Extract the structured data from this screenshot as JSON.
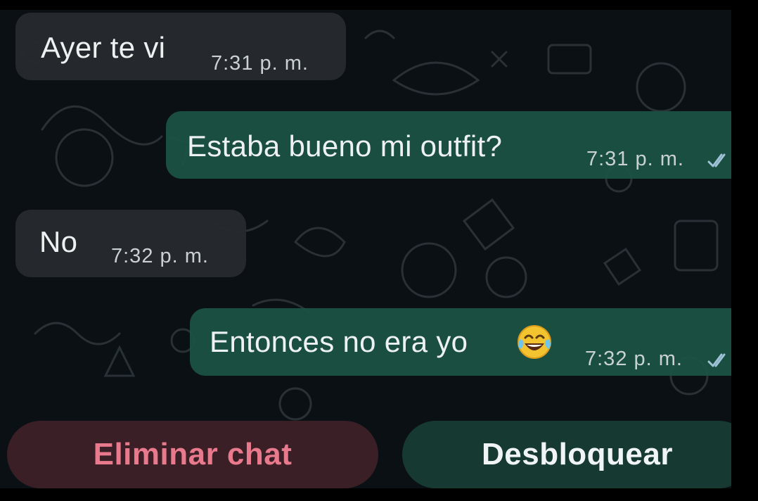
{
  "messages": [
    {
      "direction": "incoming",
      "text": "Ayer te vi",
      "time": "7:31 p. m."
    },
    {
      "direction": "outgoing",
      "text": "Estaba bueno mi outfit?",
      "time": "7:31 p. m.",
      "status": "read-ticks"
    },
    {
      "direction": "incoming",
      "text": "No",
      "time": "7:32 p. m."
    },
    {
      "direction": "outgoing",
      "text": "Entonces no era yo",
      "emoji": "tears-of-joy",
      "time": "7:32 p. m.",
      "status": "read-ticks"
    }
  ],
  "actions": {
    "delete_label": "Eliminar chat",
    "unblock_label": "Desbloquear"
  },
  "colors": {
    "incoming_bubble": "#26292e",
    "outgoing_bubble": "#1b5144",
    "delete_text": "#e97a8d",
    "delete_bg": "#3a1f26",
    "unblock_bg": "#163a32",
    "background": "#0b1014"
  }
}
